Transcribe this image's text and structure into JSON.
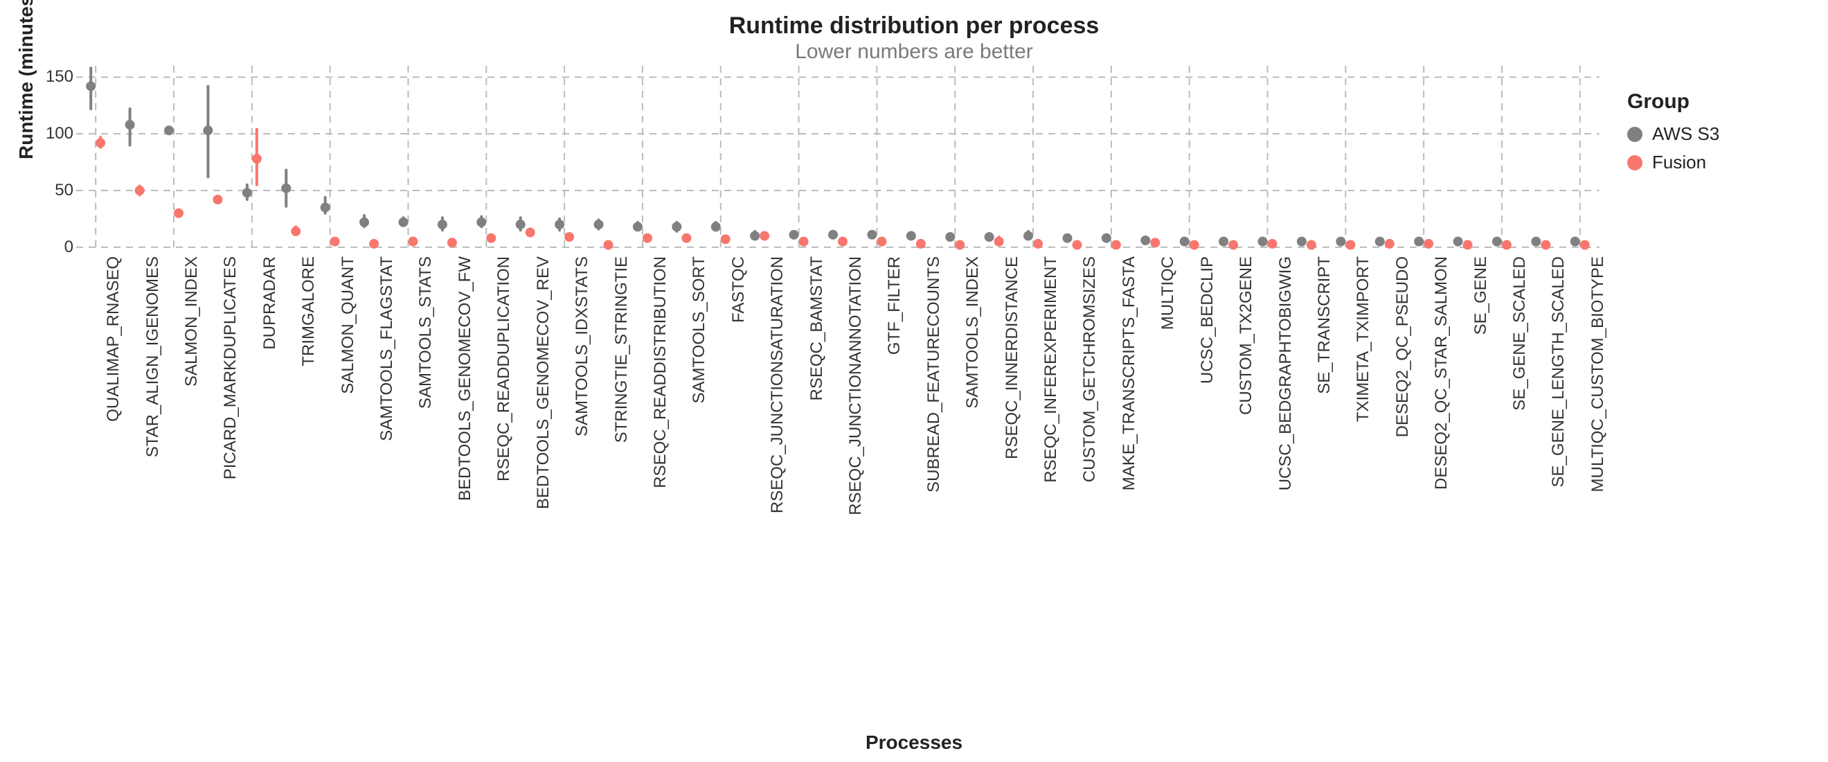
{
  "chart_data": {
    "type": "scatter",
    "title": "Runtime distribution per process",
    "subtitle": "Lower numbers are better",
    "xlabel": "Processes",
    "ylabel": "Runtime (minutes)",
    "ylim": [
      -5,
      160
    ],
    "yticks": [
      0,
      50,
      100,
      150
    ],
    "categories": [
      "QUALIMAP_RNASEQ",
      "STAR_ALIGN_IGENOMES",
      "SALMON_INDEX",
      "PICARD_MARKDUPLICATES",
      "DUPRADAR",
      "TRIMGALORE",
      "SALMON_QUANT",
      "SAMTOOLS_FLAGSTAT",
      "SAMTOOLS_STATS",
      "BEDTOOLS_GENOMECOV_FW",
      "RSEQC_READDUPLICATION",
      "BEDTOOLS_GENOMECOV_REV",
      "SAMTOOLS_IDXSTATS",
      "STRINGTIE_STRINGTIE",
      "RSEQC_READDISTRIBUTION",
      "SAMTOOLS_SORT",
      "FASTQC",
      "RSEQC_JUNCTIONSATURATION",
      "RSEQC_BAMSTAT",
      "RSEQC_JUNCTIONANNOTATION",
      "GTF_FILTER",
      "SUBREAD_FEATURECOUNTS",
      "SAMTOOLS_INDEX",
      "RSEQC_INNERDISTANCE",
      "RSEQC_INFEREXPERIMENT",
      "CUSTOM_GETCHROMSIZES",
      "MAKE_TRANSCRIPTS_FASTA",
      "MULTIQC",
      "UCSC_BEDCLIP",
      "CUSTOM_TX2GENE",
      "UCSC_BEDGRAPHTOBIGWIG",
      "SE_TRANSCRIPT",
      "TXIMETA_TXIMPORT",
      "DESEQ2_QC_PSEUDO",
      "DESEQ2_QC_STAR_SALMON",
      "SE_GENE",
      "SE_GENE_SCALED",
      "SE_GENE_LENGTH_SCALED",
      "MULTIQC_CUSTOM_BIOTYPE"
    ],
    "series": [
      {
        "name": "AWS S3",
        "color": "#808080",
        "values": [
          {
            "y": 142,
            "lo": 122,
            "hi": 158
          },
          {
            "y": 108,
            "lo": 90,
            "hi": 122
          },
          {
            "y": 103,
            "lo": 102,
            "hi": 105
          },
          {
            "y": 103,
            "lo": 62,
            "hi": 142
          },
          {
            "y": 48,
            "lo": 42,
            "hi": 55
          },
          {
            "y": 52,
            "lo": 36,
            "hi": 68
          },
          {
            "y": 35,
            "lo": 30,
            "hi": 44
          },
          {
            "y": 22,
            "lo": 18,
            "hi": 28
          },
          {
            "y": 22,
            "lo": 20,
            "hi": 26
          },
          {
            "y": 20,
            "lo": 15,
            "hi": 26
          },
          {
            "y": 22,
            "lo": 18,
            "hi": 27
          },
          {
            "y": 20,
            "lo": 15,
            "hi": 26
          },
          {
            "y": 20,
            "lo": 15,
            "hi": 25
          },
          {
            "y": 20,
            "lo": 16,
            "hi": 24
          },
          {
            "y": 18,
            "lo": 15,
            "hi": 22
          },
          {
            "y": 18,
            "lo": 14,
            "hi": 22
          },
          {
            "y": 18,
            "lo": 15,
            "hi": 22
          },
          {
            "y": 10,
            "lo": 8,
            "hi": 14
          },
          {
            "y": 11,
            "lo": 9,
            "hi": 14
          },
          {
            "y": 11,
            "lo": 9,
            "hi": 14
          },
          {
            "y": 11,
            "lo": 10,
            "hi": 12
          },
          {
            "y": 10,
            "lo": 8,
            "hi": 12
          },
          {
            "y": 9,
            "lo": 7,
            "hi": 12
          },
          {
            "y": 9,
            "lo": 7,
            "hi": 12
          },
          {
            "y": 10,
            "lo": 7,
            "hi": 14
          },
          {
            "y": 8,
            "lo": 7,
            "hi": 9
          },
          {
            "y": 8,
            "lo": 7,
            "hi": 9
          },
          {
            "y": 6,
            "lo": 5,
            "hi": 7
          },
          {
            "y": 5,
            "lo": 4,
            "hi": 6
          },
          {
            "y": 5,
            "lo": 5,
            "hi": 6
          },
          {
            "y": 5,
            "lo": 4,
            "hi": 6
          },
          {
            "y": 5,
            "lo": 5,
            "hi": 6
          },
          {
            "y": 5,
            "lo": 5,
            "hi": 6
          },
          {
            "y": 5,
            "lo": 5,
            "hi": 6
          },
          {
            "y": 5,
            "lo": 5,
            "hi": 6
          },
          {
            "y": 5,
            "lo": 5,
            "hi": 6
          },
          {
            "y": 5,
            "lo": 5,
            "hi": 6
          },
          {
            "y": 5,
            "lo": 5,
            "hi": 6
          },
          {
            "y": 5,
            "lo": 5,
            "hi": 6
          }
        ]
      },
      {
        "name": "Fusion",
        "color": "#f8766d",
        "values": [
          {
            "y": 92,
            "lo": 88,
            "hi": 97
          },
          {
            "y": 50,
            "lo": 46,
            "hi": 54
          },
          {
            "y": 30,
            "lo": 29,
            "hi": 31
          },
          {
            "y": 42,
            "lo": 40,
            "hi": 45
          },
          {
            "y": 78,
            "lo": 55,
            "hi": 104
          },
          {
            "y": 14,
            "lo": 12,
            "hi": 18
          },
          {
            "y": 5,
            "lo": 4,
            "hi": 7
          },
          {
            "y": 3,
            "lo": 2,
            "hi": 4
          },
          {
            "y": 5,
            "lo": 3,
            "hi": 8
          },
          {
            "y": 4,
            "lo": 3,
            "hi": 6
          },
          {
            "y": 8,
            "lo": 6,
            "hi": 10
          },
          {
            "y": 13,
            "lo": 11,
            "hi": 16
          },
          {
            "y": 9,
            "lo": 7,
            "hi": 11
          },
          {
            "y": 2,
            "lo": 1,
            "hi": 3
          },
          {
            "y": 8,
            "lo": 6,
            "hi": 10
          },
          {
            "y": 8,
            "lo": 6,
            "hi": 10
          },
          {
            "y": 7,
            "lo": 5,
            "hi": 9
          },
          {
            "y": 10,
            "lo": 8,
            "hi": 12
          },
          {
            "y": 5,
            "lo": 4,
            "hi": 6
          },
          {
            "y": 5,
            "lo": 4,
            "hi": 7
          },
          {
            "y": 5,
            "lo": 4,
            "hi": 6
          },
          {
            "y": 3,
            "lo": 2,
            "hi": 4
          },
          {
            "y": 2,
            "lo": 1,
            "hi": 3
          },
          {
            "y": 5,
            "lo": 3,
            "hi": 9
          },
          {
            "y": 3,
            "lo": 2,
            "hi": 5
          },
          {
            "y": 2,
            "lo": 1,
            "hi": 3
          },
          {
            "y": 2,
            "lo": 1,
            "hi": 3
          },
          {
            "y": 4,
            "lo": 3,
            "hi": 5
          },
          {
            "y": 2,
            "lo": 1,
            "hi": 3
          },
          {
            "y": 2,
            "lo": 1,
            "hi": 3
          },
          {
            "y": 3,
            "lo": 2,
            "hi": 4
          },
          {
            "y": 2,
            "lo": 1,
            "hi": 3
          },
          {
            "y": 2,
            "lo": 1,
            "hi": 3
          },
          {
            "y": 3,
            "lo": 2,
            "hi": 4
          },
          {
            "y": 3,
            "lo": 2,
            "hi": 4
          },
          {
            "y": 2,
            "lo": 1,
            "hi": 3
          },
          {
            "y": 2,
            "lo": 1,
            "hi": 3
          },
          {
            "y": 2,
            "lo": 1,
            "hi": 3
          },
          {
            "y": 2,
            "lo": 1,
            "hi": 3
          }
        ]
      }
    ],
    "legend_title": "Group",
    "legend_position": "right",
    "grid": true
  }
}
